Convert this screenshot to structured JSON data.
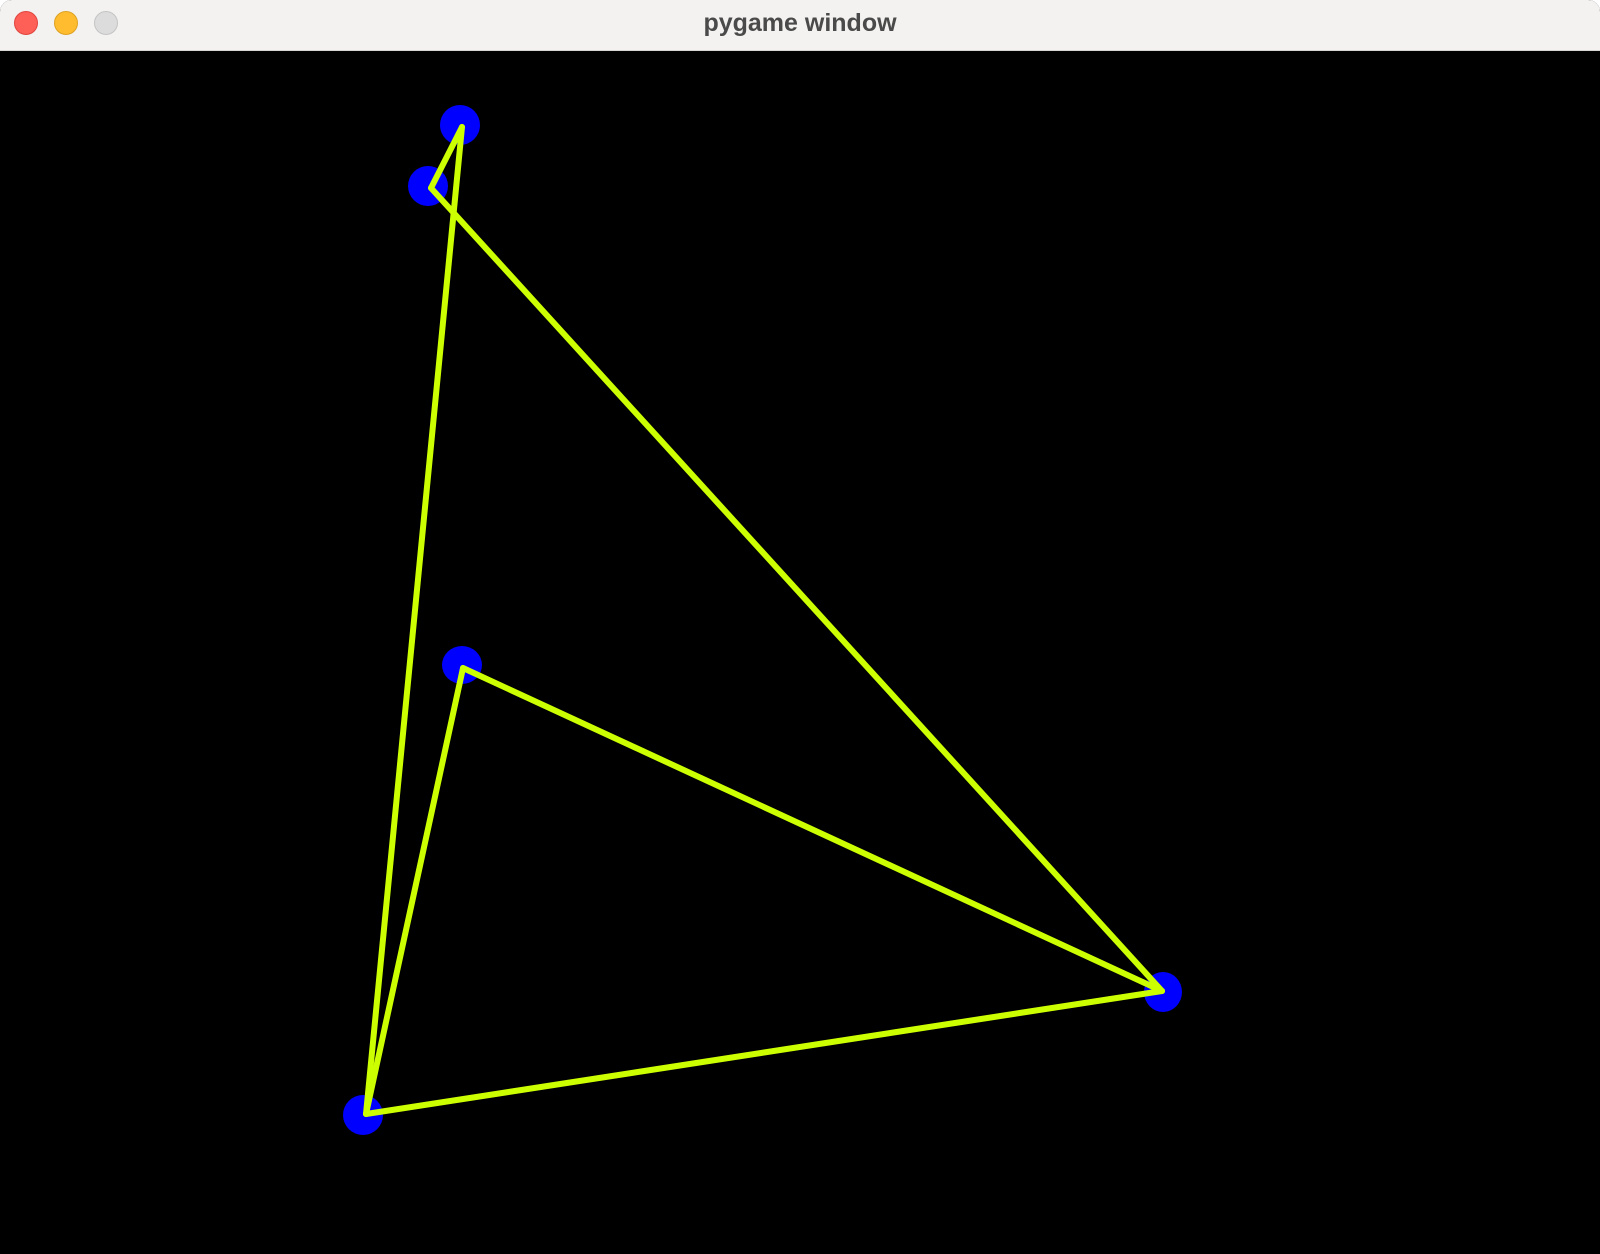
{
  "window": {
    "title": "pygame window",
    "controls": {
      "close": "close-button",
      "minimize": "minimize-button",
      "zoom": "zoom-button"
    }
  },
  "scene": {
    "background_color": "#000000",
    "vertex_color": "#0000ff",
    "edge_color": "#ccff00"
  }
}
